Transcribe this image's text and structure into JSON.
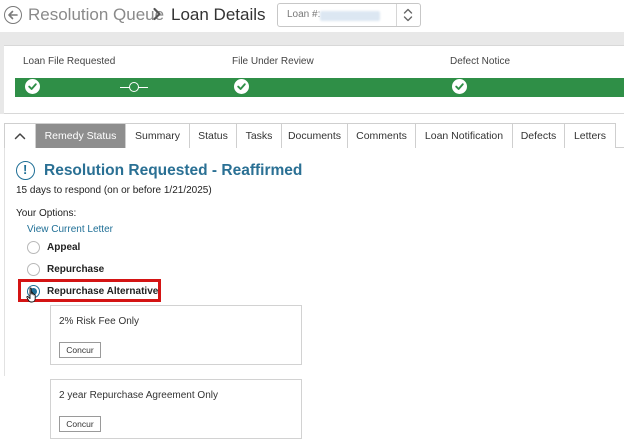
{
  "header": {
    "breadcrumb_parent": "Resolution Queue",
    "title": "Loan Details",
    "loan_selector_label": "Loan #:"
  },
  "progress": {
    "stages": [
      "Loan File Requested",
      "File Under Review",
      "Defect Notice"
    ],
    "bar_color": "#2f8f47"
  },
  "tabs": [
    "Remedy Status",
    "Summary",
    "Status",
    "Tasks",
    "Documents",
    "Comments",
    "Loan Notification",
    "Defects",
    "Letters"
  ],
  "active_tab": "Remedy Status",
  "remedy": {
    "title": "Resolution Requested - Reaffirmed",
    "deadline": "15 days to respond (on or before 1/21/2025)",
    "options_label": "Your Options:",
    "view_letter_link": "View Current Letter",
    "options": [
      "Appeal",
      "Repurchase",
      "Repurchase Alternative"
    ],
    "selected_option": "Repurchase Alternative",
    "alternatives": [
      {
        "title": "2% Risk Fee Only",
        "button": "Concur"
      },
      {
        "title": "2 year Repurchase Agreement Only",
        "button": "Concur"
      }
    ]
  },
  "colors": {
    "accent": "#2a7094",
    "highlight": "#d41414",
    "active_tab": "#8e8e8e"
  }
}
